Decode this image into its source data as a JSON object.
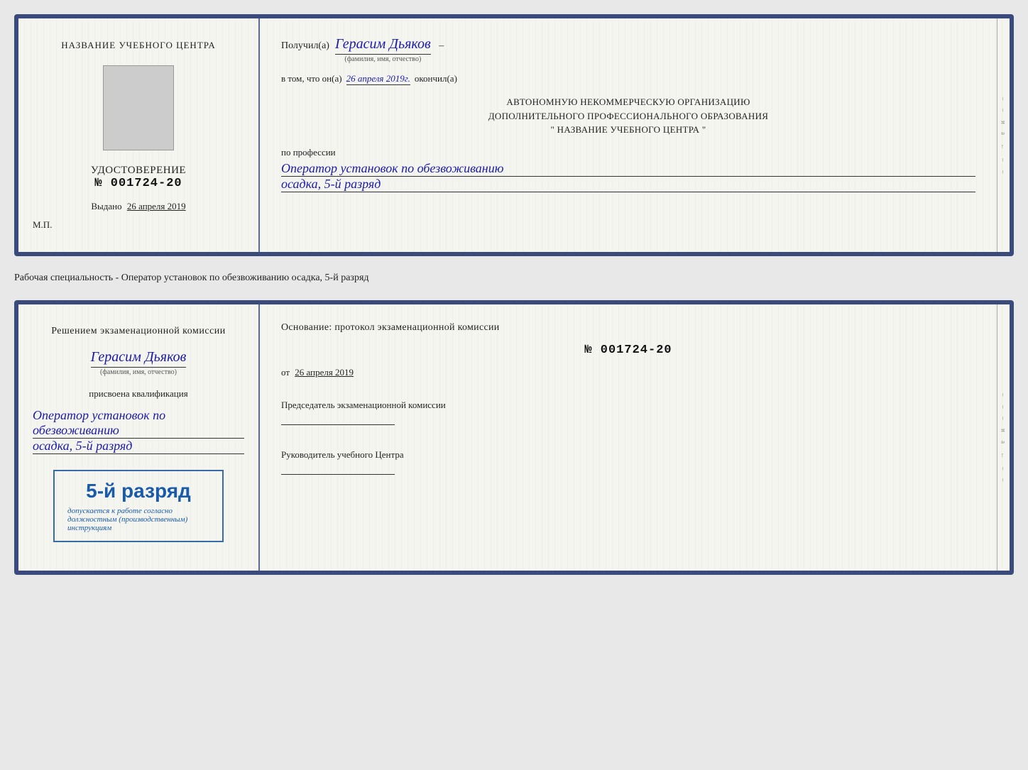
{
  "top_card": {
    "left": {
      "training_center_label": "НАЗВАНИЕ УЧЕБНОГО ЦЕНТРА",
      "photo_alt": "photo placeholder",
      "certificate_title": "УДОСТОВЕРЕНИЕ",
      "certificate_number_prefix": "№",
      "certificate_number": "001724-20",
      "issued_label": "Выдано",
      "issued_date": "26 апреля 2019",
      "stamp_label": "М.П."
    },
    "right": {
      "received_prefix": "Получил(а)",
      "recipient_name": "Герасим Дьяков",
      "recipient_subtext": "(фамилия, имя, отчество)",
      "confirmation_prefix": "в том, что он(а)",
      "confirmation_date": "26 апреля 2019г.",
      "confirmation_suffix": "окончил(а)",
      "org_line1": "АВТОНОМНУЮ НЕКОММЕРЧЕСКУЮ ОРГАНИЗАЦИЮ",
      "org_line2": "ДОПОЛНИТЕЛЬНОГО ПРОФЕССИОНАЛЬНОГО ОБРАЗОВАНИЯ",
      "org_line3": "\"   НАЗВАНИЕ УЧЕБНОГО ЦЕНТРА   \"",
      "profession_label": "по профессии",
      "profession_value": "Оператор установок по обезвоживанию",
      "rank_value": "осадка, 5-й разряд"
    }
  },
  "between_label": "Рабочая специальность - Оператор установок по обезвоживанию осадка, 5-й разряд",
  "bottom_card": {
    "left": {
      "decision_text": "Решением экзаменационной комиссии",
      "person_name": "Герасим Дьяков",
      "person_subtext": "(фамилия, имя, отчество)",
      "assigned_text": "присвоена квалификация",
      "qualification_line1": "Оператор установок по обезвоживанию",
      "qualification_line2": "осадка, 5-й разряд",
      "stamp_rank": "5-й разряд",
      "stamp_allowed_text": "допускается к  работе согласно должностным (производственным) инструкциям"
    },
    "right": {
      "basis_label": "Основание: протокол экзаменационной комиссии",
      "protocol_number_prefix": "№",
      "protocol_number": "001724-20",
      "date_prefix": "от",
      "protocol_date": "26 апреля 2019",
      "chairman_label": "Председатель экзаменационной комиссии",
      "director_label": "Руководитель учебного Центра"
    }
  },
  "side_marks": {
    "mark_and": "и",
    "mark_a": "а",
    "mark_arrow_left": "←",
    "dashes": [
      "–",
      "–",
      "–",
      "–",
      "–",
      "–",
      "–"
    ]
  }
}
